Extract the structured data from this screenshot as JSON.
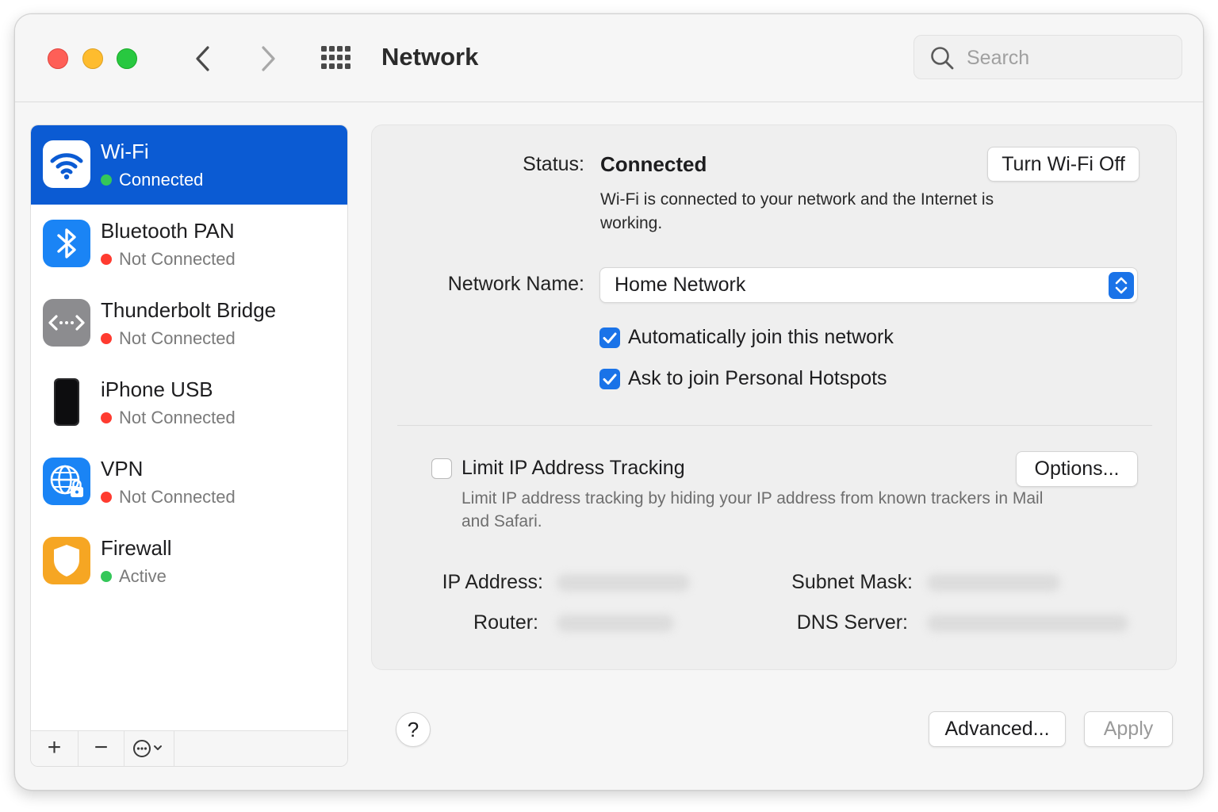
{
  "window": {
    "title": "Network"
  },
  "search": {
    "placeholder": "Search"
  },
  "sidebar": {
    "items": [
      {
        "name": "Wi-Fi",
        "status": "Connected",
        "status_color": "#34c759",
        "icon": "wifi-icon",
        "selected": true
      },
      {
        "name": "Bluetooth PAN",
        "status": "Not Connected",
        "status_color": "#ff3b30",
        "icon": "bluetooth-icon"
      },
      {
        "name": "Thunderbolt Bridge",
        "status": "Not Connected",
        "status_color": "#ff3b30",
        "icon": "thunderbolt-bridge-icon"
      },
      {
        "name": "iPhone USB",
        "status": "Not Connected",
        "status_color": "#ff3b30",
        "icon": "iphone-icon"
      },
      {
        "name": "VPN",
        "status": "Not Connected",
        "status_color": "#ff3b30",
        "icon": "vpn-globe-lock-icon"
      },
      {
        "name": "Firewall",
        "status": "Active",
        "status_color": "#34c759",
        "icon": "shield-icon"
      }
    ],
    "toolbar": {
      "add": "+",
      "remove": "−",
      "more": "⋯"
    }
  },
  "detail": {
    "status_label": "Status:",
    "status_value": "Connected",
    "status_description": "Wi-Fi is connected to your network and the Internet is working.",
    "turn_off_button": "Turn Wi-Fi Off",
    "network_name_label": "Network Name:",
    "network_name_value": "Home Network",
    "auto_join_label": "Automatically join this network",
    "auto_join_checked": true,
    "ask_hotspots_label": "Ask to join Personal Hotspots",
    "ask_hotspots_checked": true,
    "limit_ip_label": "Limit IP Address Tracking",
    "limit_ip_checked": false,
    "limit_ip_description": "Limit IP address tracking by hiding your IP address from known trackers in Mail and Safari.",
    "options_button": "Options...",
    "ip_address_label": "IP Address:",
    "subnet_mask_label": "Subnet Mask:",
    "router_label": "Router:",
    "dns_server_label": "DNS Server:"
  },
  "footer": {
    "help": "?",
    "advanced_button": "Advanced...",
    "apply_button": "Apply"
  },
  "colors": {
    "accent": "#0b5bd3",
    "checkbox": "#1a73e8",
    "connected": "#34c759",
    "disconnected": "#ff3b30"
  }
}
